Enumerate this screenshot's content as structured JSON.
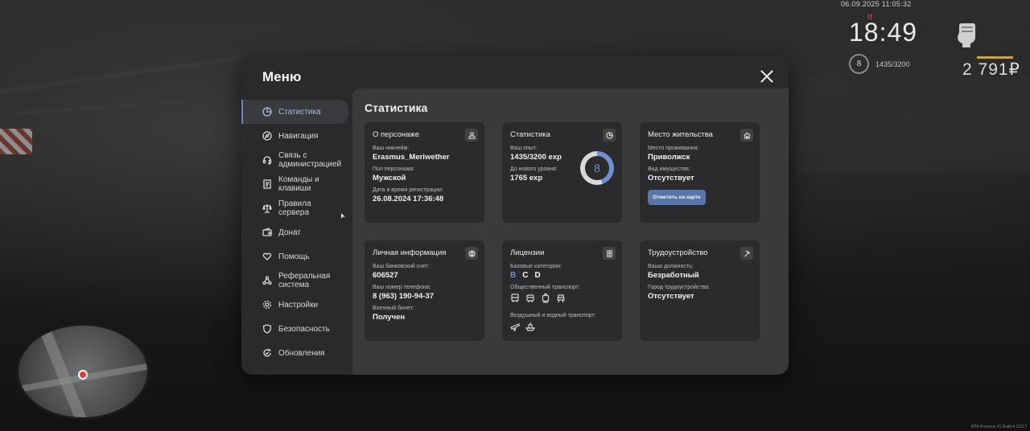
{
  "hud": {
    "datetime": "06.09.2025 11:05:32",
    "time": "18:49",
    "alert": "!!",
    "level": "8",
    "exp": "1435/3200",
    "money": "2 791₽",
    "build": "MTA Province #1 Build 4.12117"
  },
  "menu": {
    "title": "Меню",
    "sidebar": [
      {
        "label": "Статистика",
        "icon": "pie-chart-icon",
        "active": true
      },
      {
        "label": "Навигация",
        "icon": "compass-icon"
      },
      {
        "label": "Связь с администрацией",
        "icon": "headset-icon"
      },
      {
        "label": "Команды и клавиши",
        "icon": "document-icon"
      },
      {
        "label": "Правила сервера",
        "icon": "scales-icon"
      },
      {
        "label": "Донат",
        "icon": "wallet-icon"
      },
      {
        "label": "Помощь",
        "icon": "heart-hands-icon"
      },
      {
        "label": "Реферальная система",
        "icon": "network-icon"
      },
      {
        "label": "Настройки",
        "icon": "gear-icon"
      },
      {
        "label": "Безопасность",
        "icon": "shield-icon"
      },
      {
        "label": "Обновления",
        "icon": "refresh-icon"
      }
    ]
  },
  "content": {
    "title": "Статистика",
    "character": {
      "title": "О персонаже",
      "nickname_label": "Ваш никнейм:",
      "nickname": "Erasmus_Meriwether",
      "gender_label": "Пол персонажа:",
      "gender": "Мужской",
      "reg_label": "Дата и время регистрации:",
      "reg": "26.08.2024 17:36:48"
    },
    "stats": {
      "title": "Статистика",
      "exp_label": "Ваш опыт:",
      "exp": "1435/3200 exp",
      "next_label": "До нового уровня:",
      "next": "1765 exp",
      "level": "8",
      "progress": 0.4484,
      "ring_color": "#6f8fcf"
    },
    "residence": {
      "title": "Место жительства",
      "place_label": "Место проживания:",
      "place": "Приволжск",
      "property_label": "Вид имущества:",
      "property": "Отсутствует",
      "map_button": "Отметить на карте"
    },
    "personal": {
      "title": "Личная информация",
      "bank_label": "Ваш банковский счет:",
      "bank": "606527",
      "phone_label": "Ваш номер телефона:",
      "phone": "8 (963) 190-94-37",
      "military_label": "Военный билет:",
      "military": "Получен"
    },
    "licenses": {
      "title": "Лицензии",
      "base_label": "Базовые категории:",
      "cat_b": "B",
      "cat_c": "C",
      "cat_d": "D",
      "public_label": "Общественный транспорт:",
      "air_water_label": "Воздушный и водный транспорт:"
    },
    "employment": {
      "title": "Трудоустройство",
      "position_label": "Ваша должность:",
      "position": "Безработный",
      "city_label": "Город трудоустройства:",
      "city": "Отсутствует"
    }
  }
}
